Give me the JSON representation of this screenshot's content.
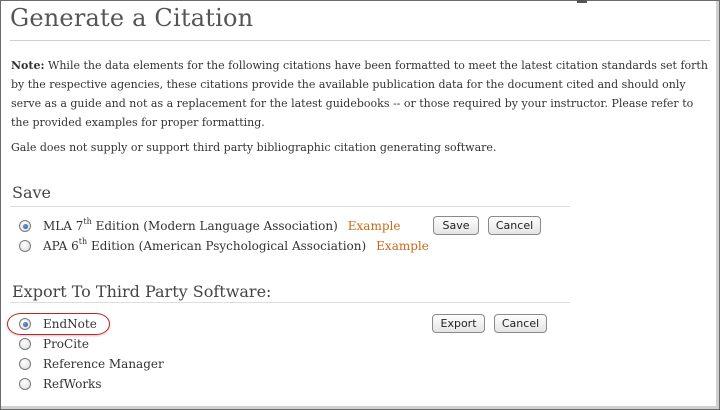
{
  "page": {
    "title": "Generate a Citation"
  },
  "note": {
    "label": "Note:",
    "text": " While the data elements for the following citations have been formatted to meet the latest citation standards set forth by the respective agencies, these citations provide the available publication data for the document cited and should only serve as a guide and not as a replacement for the latest guidebooks -- or those required by your instructor. Please refer to the provided examples for proper formatting.",
    "disclaimer": "Gale does not supply or support third party bibliographic citation generating software."
  },
  "save_section": {
    "heading": "Save",
    "options": [
      {
        "prefix": "MLA 7",
        "sup": "th",
        "suffix": " Edition (Modern Language Association)",
        "example": "Example",
        "checked": true
      },
      {
        "prefix": "APA 6",
        "sup": "th",
        "suffix": " Edition (American Psychological Association)",
        "example": "Example",
        "checked": false
      }
    ],
    "save_label": "Save",
    "cancel_label": "Cancel"
  },
  "export_section": {
    "heading": "Export To Third Party Software:",
    "options": [
      {
        "label": "EndNote",
        "checked": true
      },
      {
        "label": "ProCite",
        "checked": false
      },
      {
        "label": "Reference Manager",
        "checked": false
      },
      {
        "label": "RefWorks",
        "checked": false
      }
    ],
    "export_label": "Export",
    "cancel_label": "Cancel"
  },
  "colors": {
    "example_link": "#c86a1a",
    "highlight_ring": "#b22a2a"
  }
}
